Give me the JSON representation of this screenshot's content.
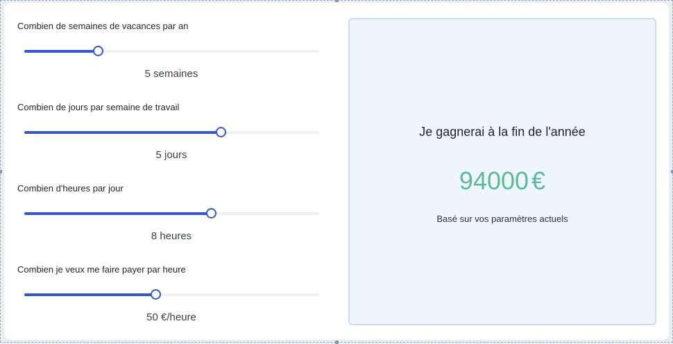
{
  "sliders": [
    {
      "label": "Combien de semaines de vacances par an",
      "value_text": "5 semaines",
      "fraction": 0.249
    },
    {
      "label": "Combien de jours par semaine de travail",
      "value_text": "5 jours",
      "fraction": 0.665
    },
    {
      "label": "Combien d'heures par jour",
      "value_text": "8 heures",
      "fraction": 0.633
    },
    {
      "label": "Combien je veux me faire payer par heure",
      "value_text": "50 €/heure",
      "fraction": 0.444
    }
  ],
  "result": {
    "title": "Je gagnerai à la fin de l'année",
    "amount": "94000",
    "currency": "€",
    "note": "Basé sur vos paramètres actuels"
  },
  "colors": {
    "accent": "#3256d8",
    "amount": "#5dbb94",
    "result_bg": "#eef5ff",
    "result_border": "#c7ddf1"
  }
}
